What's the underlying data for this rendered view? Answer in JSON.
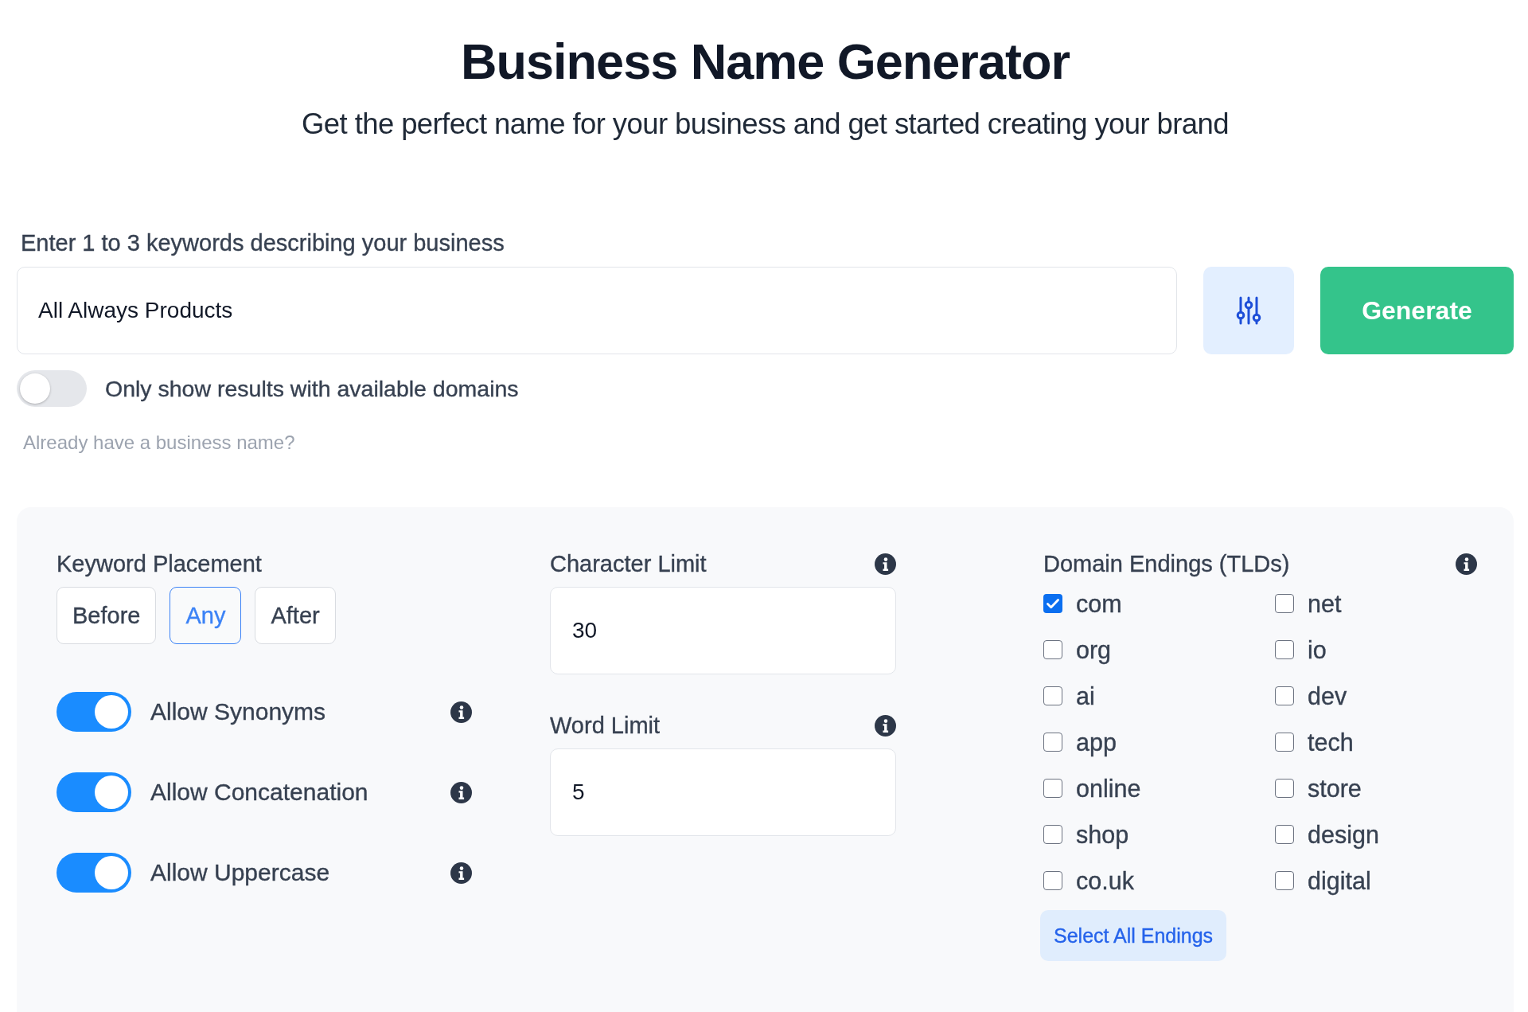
{
  "header": {
    "title": "Business Name Generator",
    "subtitle": "Get the perfect name for your business and get started creating your brand"
  },
  "search": {
    "label": "Enter 1 to 3 keywords describing your business",
    "value": "All Always Products",
    "generate_button": "Generate"
  },
  "domain_filter": {
    "label": "Only show results with available domains",
    "on": false
  },
  "existing_name_link": "Already have a business name?",
  "options": {
    "keyword_placement": {
      "label": "Keyword Placement",
      "choices": [
        {
          "label": "Before",
          "selected": false
        },
        {
          "label": "Any",
          "selected": true
        },
        {
          "label": "After",
          "selected": false
        }
      ]
    },
    "toggles": [
      {
        "label": "Allow Synonyms",
        "on": true
      },
      {
        "label": "Allow Concatenation",
        "on": true
      },
      {
        "label": "Allow Uppercase",
        "on": true
      }
    ],
    "limits": [
      {
        "label": "Character Limit",
        "value": "30"
      },
      {
        "label": "Word Limit",
        "value": "5"
      }
    ],
    "domain_endings": {
      "label": "Domain Endings (TLDs)",
      "endings": [
        {
          "label": "com",
          "checked": true
        },
        {
          "label": "net",
          "checked": false
        },
        {
          "label": "org",
          "checked": false
        },
        {
          "label": "io",
          "checked": false
        },
        {
          "label": "ai",
          "checked": false
        },
        {
          "label": "dev",
          "checked": false
        },
        {
          "label": "app",
          "checked": false
        },
        {
          "label": "tech",
          "checked": false
        },
        {
          "label": "online",
          "checked": false
        },
        {
          "label": "store",
          "checked": false
        },
        {
          "label": "shop",
          "checked": false
        },
        {
          "label": "design",
          "checked": false
        },
        {
          "label": "co.uk",
          "checked": false
        },
        {
          "label": "digital",
          "checked": false
        }
      ],
      "select_all_button": "Select All Endings"
    }
  }
}
